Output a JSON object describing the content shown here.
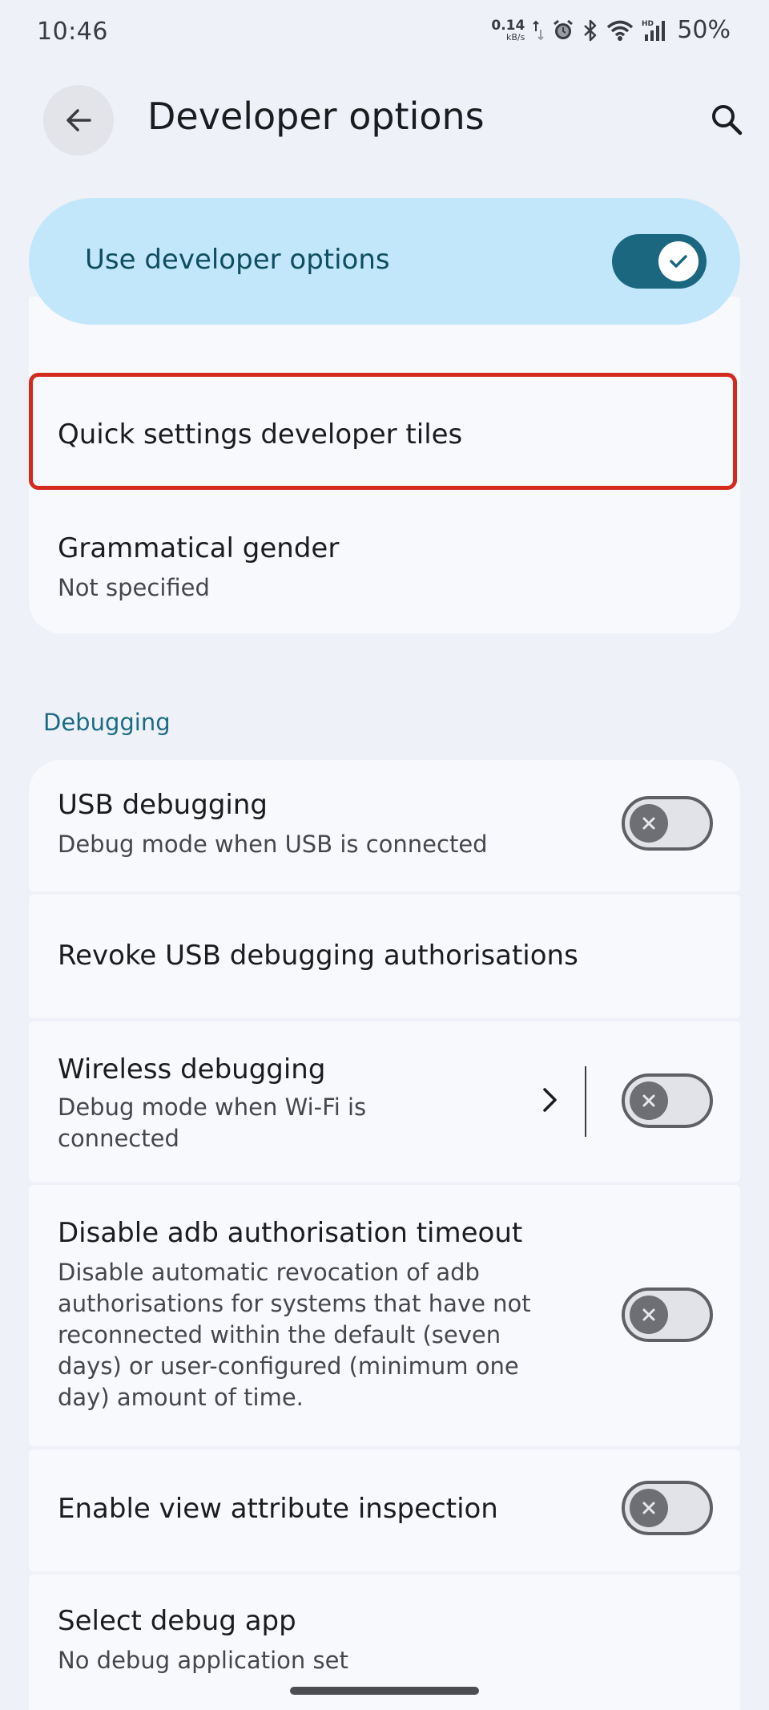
{
  "status_bar": {
    "time": "10:46",
    "net_speed_value": "0.14",
    "net_speed_unit": "kB/s",
    "battery": "50%"
  },
  "header": {
    "title": "Developer options"
  },
  "master_switch": {
    "label": "Use developer options",
    "enabled": true
  },
  "items_top": [
    {
      "title": "Quick settings developer tiles"
    },
    {
      "title": "Grammatical gender",
      "subtitle": "Not specified"
    }
  ],
  "debugging": {
    "header": "Debugging",
    "items": [
      {
        "title": "USB debugging",
        "subtitle": "Debug mode when USB is connected",
        "enabled": false
      },
      {
        "title": "Revoke USB debugging authorisations"
      },
      {
        "title": "Wireless debugging",
        "subtitle": "Debug mode when Wi-Fi is connected",
        "enabled": false
      },
      {
        "title": "Disable adb authorisation timeout",
        "subtitle": "Disable automatic revocation of adb authorisations for systems that have not reconnected within the default (seven days) or user-configured (minimum one day) amount of time.",
        "enabled": false
      },
      {
        "title": "Enable view attribute inspection",
        "enabled": false
      },
      {
        "title": "Select debug app",
        "subtitle": "No debug application set"
      }
    ]
  },
  "colors": {
    "accent": "#1b6780",
    "master_card_bg": "#c2e7fb",
    "highlight_border": "#d42a1e",
    "section_header": "#1c6b84"
  }
}
